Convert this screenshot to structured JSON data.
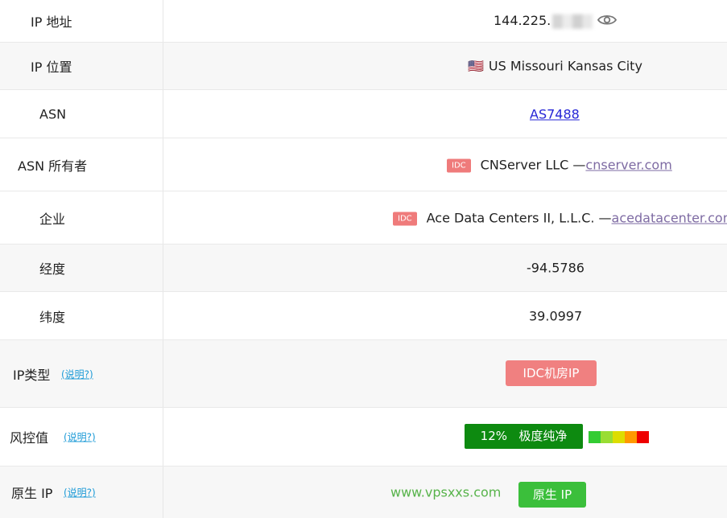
{
  "rows": {
    "ip_address": {
      "label": "IP 地址",
      "value": "144.225."
    },
    "ip_location": {
      "label": "IP 位置",
      "flag": "🇺🇸",
      "value": "US Missouri Kansas City"
    },
    "asn": {
      "label": "ASN",
      "value": "AS7488"
    },
    "asn_owner": {
      "label": "ASN 所有者",
      "badge": "IDC",
      "name": "CNServer LLC —",
      "link": "cnserver.com"
    },
    "company": {
      "label": "企业",
      "badge": "IDC",
      "name": "Ace Data Centers II, L.L.C. —",
      "link": "acedatacenter.com"
    },
    "longitude": {
      "label": "经度",
      "value": "-94.5786"
    },
    "latitude": {
      "label": "纬度",
      "value": "39.0997"
    },
    "ip_type": {
      "label": "IP类型",
      "help": "(说明?)",
      "value": "IDC机房IP"
    },
    "risk": {
      "label": "风控值",
      "help": "(说明?)",
      "percent": "12%",
      "text": "极度纯净",
      "scale_colors": [
        "#33cc33",
        "#99dd33",
        "#dddd00",
        "#ff9900",
        "#ee0000"
      ]
    },
    "native_ip": {
      "label": "原生 IP",
      "help": "(说明?)",
      "watermark": "www.vpsxxs.com",
      "value": "原生 IP"
    }
  },
  "colors": {
    "link": "#2626d6",
    "visited_link": "#7e6ba3",
    "help": "#1e9bd7",
    "idc": "#ef7b7b",
    "risk_green": "#0d8a10",
    "native_green": "#3bbf3b"
  }
}
